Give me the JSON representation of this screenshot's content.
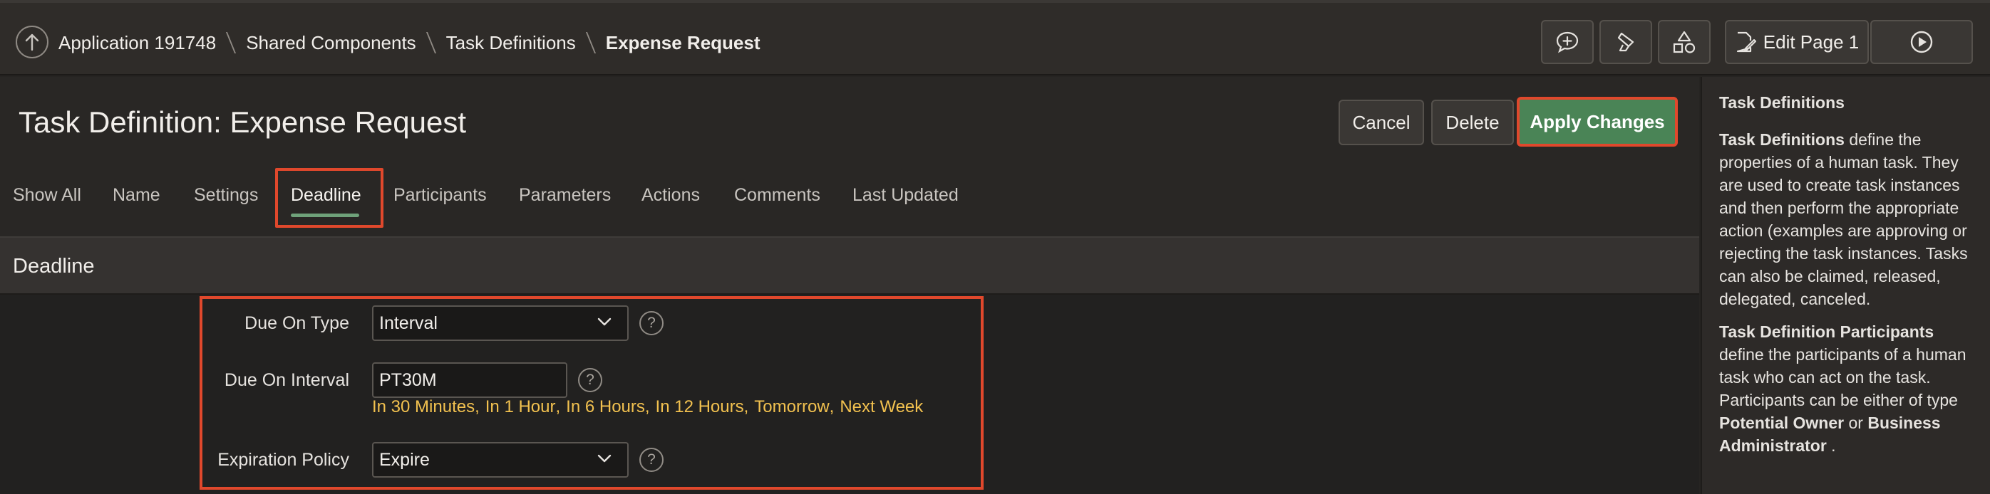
{
  "breadcrumb": {
    "items": [
      "Application 191748",
      "Shared Components",
      "Task Definitions",
      "Expense Request"
    ]
  },
  "toolbar": {
    "edit_page_label": "Edit Page 1"
  },
  "page": {
    "title": "Task Definition: Expense Request"
  },
  "actions": {
    "cancel": "Cancel",
    "delete": "Delete",
    "apply": "Apply Changes"
  },
  "tabs": [
    {
      "label": "Show All"
    },
    {
      "label": "Name"
    },
    {
      "label": "Settings"
    },
    {
      "label": "Deadline"
    },
    {
      "label": "Participants"
    },
    {
      "label": "Parameters"
    },
    {
      "label": "Actions"
    },
    {
      "label": "Comments"
    },
    {
      "label": "Last Updated"
    }
  ],
  "active_tab": "Deadline",
  "region": {
    "title": "Deadline"
  },
  "form": {
    "due_on_type": {
      "label": "Due On Type",
      "value": "Interval"
    },
    "due_on_interval": {
      "label": "Due On Interval",
      "value": "PT30M"
    },
    "expiration_policy": {
      "label": "Expiration Policy",
      "value": "Expire"
    },
    "quick_picks": [
      "In 30 Minutes",
      "In 1 Hour",
      "In 6 Hours",
      "In 12 Hours",
      "Tomorrow",
      "Next Week"
    ],
    "help_glyph": "?"
  },
  "help_panel": {
    "heading": "Task Definitions",
    "p1_bold": "Task Definitions",
    "p1_rest": " define the properties of a human task. They are used to create task instances and then perform the appropriate action (examples are approving or rejecting the task instances. Tasks can also be claimed, released, delegated, canceled.",
    "p2_bold": "Task Definition Participants",
    "p2_rest": " define the participants of a human task who can act on the task. Participants can be either of type ",
    "p2_bold2": "Potential Owner",
    "p2_mid": " or ",
    "p2_bold3": "Business Administrator",
    "p2_end": " ."
  },
  "colors": {
    "accent_green": "#4a8456",
    "highlight_red": "#e0482c",
    "quickpick_yellow": "#f2c14f"
  },
  "icons": [
    "up-arrow-icon",
    "add-comment-icon",
    "highlighter-icon",
    "shapes-icon",
    "edit-page-icon",
    "run-icon",
    "chevron-down-icon",
    "help-icon"
  ]
}
